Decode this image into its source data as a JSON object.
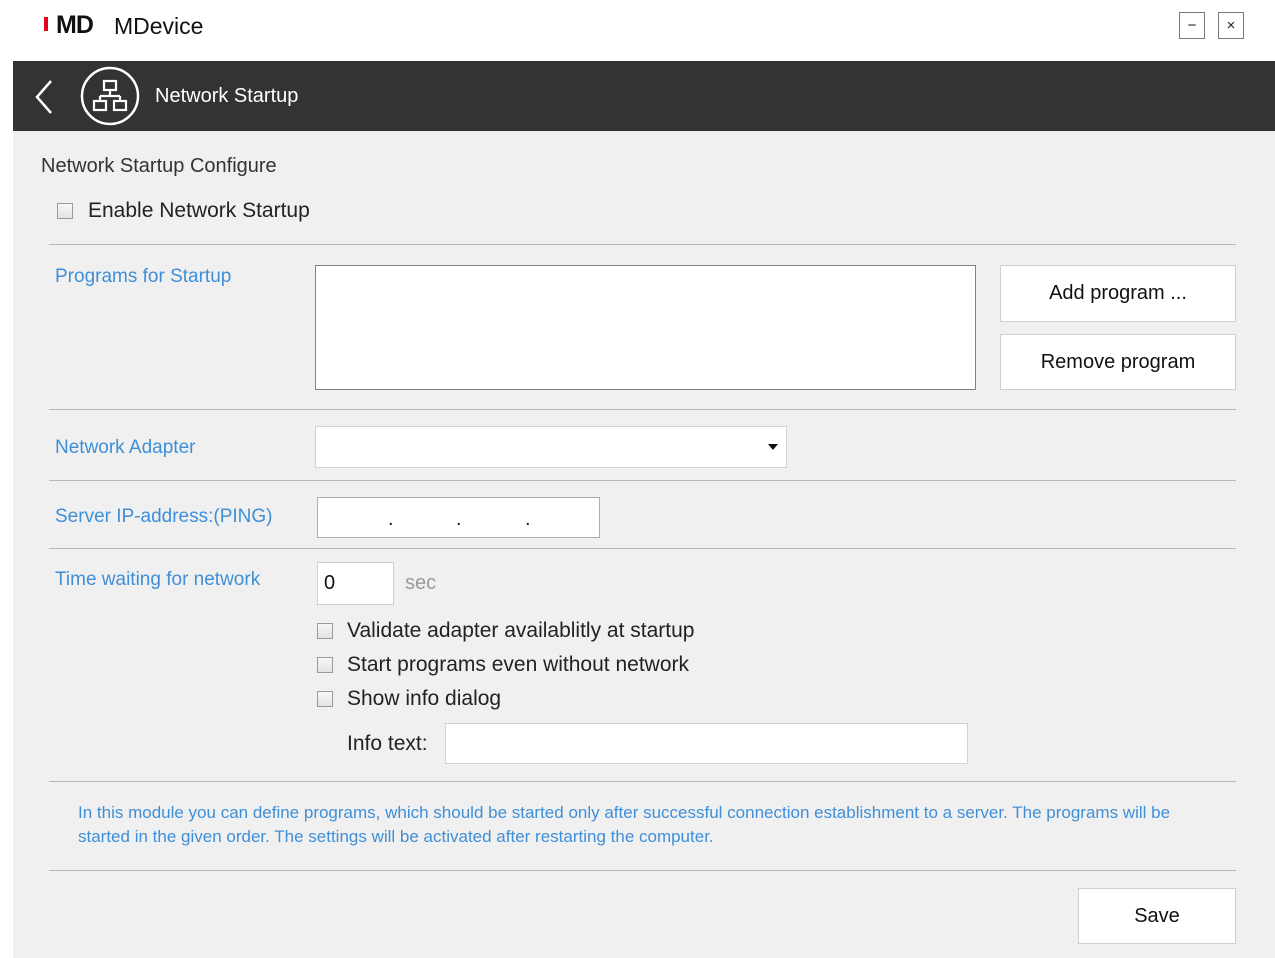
{
  "app": {
    "logo": "MD",
    "title": "MDevice",
    "minimize_icon": "−",
    "close_icon": "×"
  },
  "header": {
    "title": "Network Startup"
  },
  "config": {
    "section_title": "Network Startup Configure",
    "enable_label": "Enable Network Startup",
    "programs_label": "Programs for Startup",
    "add_program": "Add program ...",
    "remove_program": "Remove program",
    "adapter_label": "Network Adapter",
    "adapter_value": "",
    "ip_label": "Server IP-address:(PING)",
    "ip_dots": [
      ".",
      ".",
      "."
    ],
    "wait_label": "Time waiting for network",
    "wait_value": "0",
    "wait_unit": "sec",
    "validate_label": "Validate adapter availablitly at startup",
    "start_without_label": "Start programs even without network",
    "show_info_label": "Show info dialog",
    "info_text_label": "Info text:",
    "info_text_value": "",
    "description": "In this module you can define programs, which should be started only after successful connection establishment to a server. The programs will be started in the given order. The settings will be activated after restarting the computer.",
    "save": "Save"
  },
  "colors": {
    "accent": "#3f8fd8",
    "header_bg": "#333333",
    "logo_red": "#e2001a",
    "content_bg": "#f0f0f0"
  },
  "icons": {
    "back": "chevron-left-icon",
    "section": "network-topology-icon"
  }
}
